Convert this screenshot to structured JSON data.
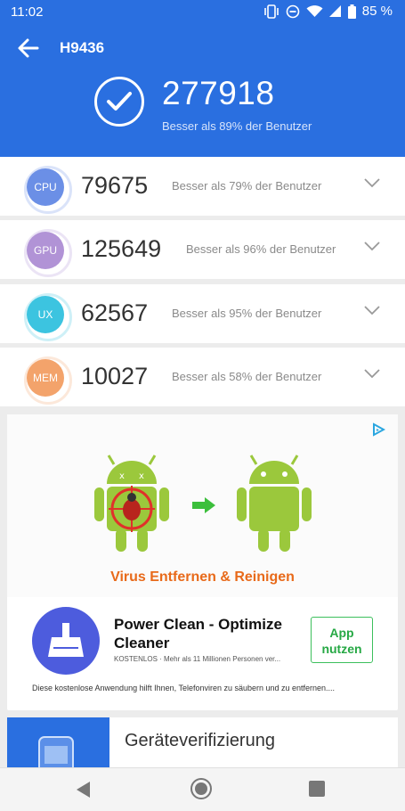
{
  "status_bar": {
    "time": "11:02",
    "battery": "85 %"
  },
  "header": {
    "device": "H9436",
    "total_score": "277918",
    "total_rank": "Besser als 89% der Benutzer",
    "accent": "#2a6fe0"
  },
  "scores": [
    {
      "label": "CPU",
      "value": "79675",
      "rank": "Besser als 79% der Benutzer",
      "color": "#6b8fe6"
    },
    {
      "label": "GPU",
      "value": "125649",
      "rank": "Besser als 96% der Benutzer",
      "color": "#b193d6"
    },
    {
      "label": "UX",
      "value": "62567",
      "rank": "Besser als 95% der Benutzer",
      "color": "#3cc4e0"
    },
    {
      "label": "MEM",
      "value": "10027",
      "rank": "Besser als 58% der Benutzer",
      "color": "#f3a36b"
    }
  ],
  "ad": {
    "tagline": "Virus Entfernen & Reinigen",
    "title": "Power Clean - Optimize Cleaner",
    "meta": "KOSTENLOS · Mehr als 11 Millionen Personen ver...",
    "cta": "App nutzen",
    "description": "Diese kostenlose Anwendung hilft Ihnen, Telefonviren zu säubern und zu entfernen...."
  },
  "verification": {
    "label": "Geräteverifizierung"
  }
}
